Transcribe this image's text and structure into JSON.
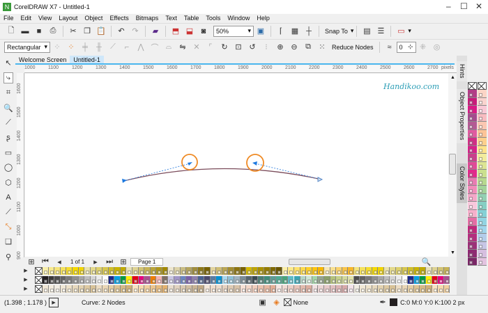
{
  "title": "CorelDRAW X7 - Untitled-1",
  "menu": [
    "File",
    "Edit",
    "View",
    "Layout",
    "Object",
    "Effects",
    "Bitmaps",
    "Text",
    "Table",
    "Tools",
    "Window",
    "Help"
  ],
  "toolbar": {
    "zoom": "50%",
    "snap_to": "Snap To"
  },
  "propertybar": {
    "mode": "Rectangular",
    "reduce_nodes": "Reduce Nodes",
    "smoothness": "0"
  },
  "tabs": [
    "Welcome Screen",
    "Untitled-1"
  ],
  "ruler": {
    "h": [
      "1000",
      "1100",
      "1200",
      "1300",
      "1400",
      "1500",
      "1600",
      "1700",
      "1800",
      "1900",
      "2000",
      "2100",
      "2200",
      "2300",
      "2400",
      "2500",
      "2600",
      "2700"
    ],
    "unit": "pixels",
    "v": [
      "1600",
      "1500",
      "1400",
      "1300",
      "1200",
      "1100",
      "1000",
      "900"
    ]
  },
  "watermark": "Handikoo.com",
  "pagebar": {
    "count": "1 of 1",
    "page": "Page 1"
  },
  "dockers": [
    "Hints",
    "Object Properties",
    "Color Styles"
  ],
  "status": {
    "coords": "(1.398 ; 1.178 )",
    "selection": "Curve: 2 Nodes",
    "fill": "None",
    "outline": "C:0 M:0 Y:0 K:100  2 px"
  },
  "palette": {
    "row1": [
      "#f7eeaa",
      "#f7e98e",
      "#f5e47a",
      "#f5e15a",
      "#f5dc2e",
      "#f4d800",
      "#f1d400",
      "#e9e2a9",
      "#e3d88a",
      "#ddd06c",
      "#d6c64e",
      "#cfbd2a",
      "#c8b300",
      "#c0aa00",
      "#e8e1b5",
      "#ddd293",
      "#d1c274",
      "#c6b356",
      "#baa43a",
      "#ae961b",
      "#a28800",
      "#ece4cc",
      "#dcd2a8",
      "#c8bb82",
      "#b4a45e",
      "#a08d3c",
      "#8c7719",
      "#786200",
      "#e2d39d",
      "#cfbd75",
      "#b9a553",
      "#a38d31",
      "#8d7511",
      "#776000",
      "#d3b800",
      "#bea400",
      "#a99000",
      "#947c00",
      "#7f6900",
      "#6a5600",
      "#fcefa8",
      "#fde98a",
      "#fde06a",
      "#fdd84a",
      "#fdcf2a",
      "#fdc40e",
      "#f8b700",
      "#f7e7b3",
      "#f9df8f",
      "#f9d16c",
      "#f8c44a",
      "#f7b728"
    ],
    "row2": [
      "#231f20",
      "#3c3a3a",
      "#4d4d4d",
      "#636363",
      "#787878",
      "#8e8e8e",
      "#a6a6a6",
      "#bdbdbd",
      "#d4d4d4",
      "#ebebeb",
      "#ffffff",
      "#1d2a8c",
      "#00a0e3",
      "#009a44",
      "#ffed00",
      "#e30613",
      "#e5007e",
      "#a94f8f",
      "#ef7d00",
      "#f4b2b0",
      "#7f6e65",
      "#c9c5e3",
      "#a196c8",
      "#6b84c1",
      "#7760a9",
      "#8d7fae",
      "#4b6190",
      "#4a4a6e",
      "#5a7ca3",
      "#0091d4",
      "#a7d8f0",
      "#8fbfd5",
      "#9fb3c0",
      "#7b8c97",
      "#56646e",
      "#3b4a51",
      "#4c7d74",
      "#3f8c7a",
      "#5d9c94",
      "#4daa94",
      "#47a57b",
      "#5fbcc9",
      "#3aa5b5",
      "#b4d5c6",
      "#cfe7d5",
      "#a2d5a6",
      "#95a58f",
      "#8aa06a",
      "#b3c27a",
      "#c5d08a",
      "#d2d89a",
      "#dfe0aa"
    ],
    "row3": [
      "#efe5d4",
      "#f2ebdd",
      "#f1ece2",
      "#f0e7d5",
      "#ede1c9",
      "#e6d8bc",
      "#e2d2b0",
      "#ddc9a1",
      "#d8c297",
      "#ecdcc2",
      "#e9d6b5",
      "#e3cda4",
      "#dcc393",
      "#d6b985",
      "#d0b077",
      "#f9e2c1",
      "#f6d9ae",
      "#f1cf9e",
      "#ecc58e",
      "#e7bb7e",
      "#e2b16e",
      "#e8dccd",
      "#e1d2bf",
      "#d9c8b0",
      "#d1bea2",
      "#c9b494",
      "#c1aa86",
      "#f3e6d8",
      "#efdccb",
      "#eadbcb",
      "#e4d1bf",
      "#decab3",
      "#d8c2a8",
      "#f7e0d5",
      "#f3d6c8",
      "#efccbb",
      "#ebc2ae",
      "#e7b8a1",
      "#e3ae94",
      "#f5e5e0",
      "#f0dad3",
      "#ebcfc6",
      "#e6c4b9",
      "#e1b9ac",
      "#dcae9f",
      "#f0e0e0",
      "#ebd5d5",
      "#e6caca",
      "#e1bfbf",
      "#dcb4b4",
      "#d7a9a9",
      "#f2e2e8"
    ],
    "vcol1": [
      "#b23d86",
      "#c81b7a",
      "#d81b86",
      "#a54a8e",
      "#b45a94",
      "#e05aa0",
      "#cf2f85",
      "#d6238a",
      "#c9408c",
      "#e04a97",
      "#e02a8a",
      "#e87bb2",
      "#f08cba",
      "#f4a7c8",
      "#f8c8dc",
      "#f5b0cb",
      "#e36ea5",
      "#c0287c",
      "#b32f7f",
      "#9c2f78",
      "#8d2a72",
      "#7a2666"
    ],
    "vcol2": [
      "#fcd5c6",
      "#fad4cf",
      "#f9c9d6",
      "#f8bcc1",
      "#fbc7b2",
      "#fcc497",
      "#fdd08d",
      "#fee38b",
      "#f2ec9c",
      "#dde593",
      "#cbe08e",
      "#b7d98f",
      "#a3d39a",
      "#93d0b2",
      "#87cfc4",
      "#84d1d6",
      "#92d4e2",
      "#a0d6ec",
      "#b3cdea",
      "#c7c6e6",
      "#d6bfe0",
      "#e3c3e0"
    ]
  }
}
